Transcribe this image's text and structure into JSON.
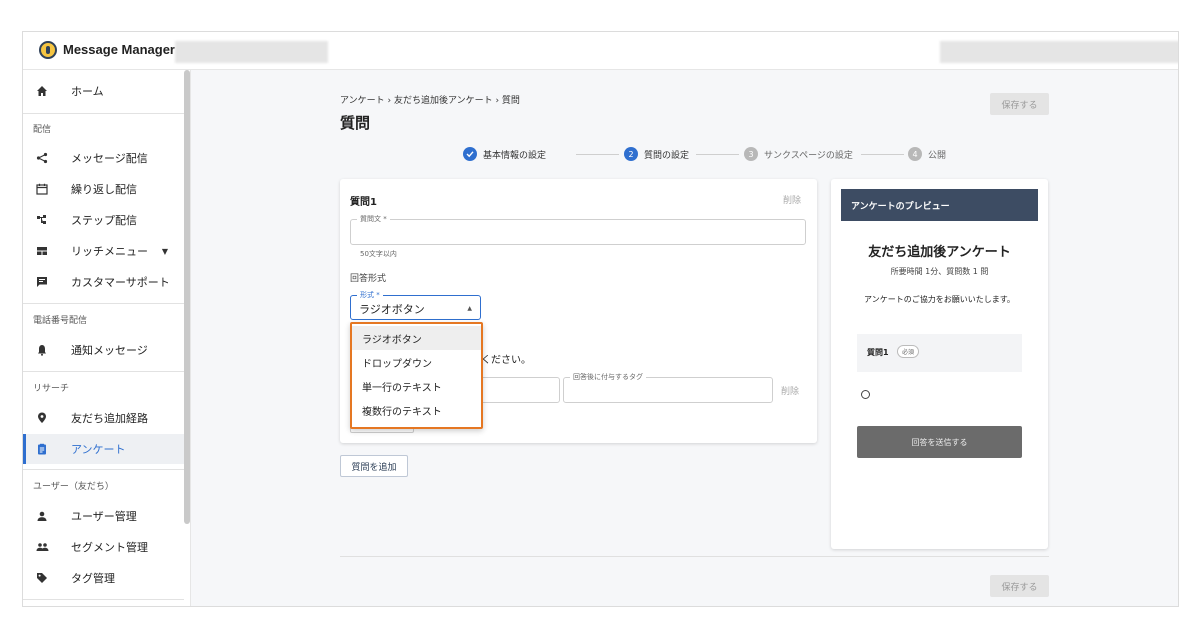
{
  "app": {
    "title": "Message Manager"
  },
  "sidebar": {
    "home": "ホーム",
    "section_delivery": "配信",
    "message_delivery": "メッセージ配信",
    "repeat_delivery": "繰り返し配信",
    "step_delivery": "ステップ配信",
    "rich_menu": "リッチメニュー",
    "customer_support": "カスタマーサポート",
    "section_phone": "電話番号配信",
    "notification_message": "通知メッセージ",
    "section_research": "リサーチ",
    "friend_route": "友だち追加経路",
    "survey": "アンケート",
    "section_users": "ユーザー（友だち）",
    "user_management": "ユーザー管理",
    "segment_management": "セグメント管理",
    "tag_management": "タグ管理"
  },
  "breadcrumb": "アンケート › 友だち追加後アンケート › 質問",
  "page_title": "質問",
  "save_label": "保存する",
  "stepper": {
    "step1": "基本情報の設定",
    "step2_num": "2",
    "step2": "質問の設定",
    "step3_num": "3",
    "step3": "サンクスページの設定",
    "step4_num": "4",
    "step4": "公開"
  },
  "question": {
    "title": "質問1",
    "delete": "削除",
    "text_label": "質問文 *",
    "text_value": "",
    "helper": "50文字以内",
    "answer_format": "回答形式",
    "format_label": "形式 *",
    "format_value": "ラジオボタン",
    "instruction_tail": "ください。",
    "tag_label": "回答後に付与するタグ",
    "option_delete": "削除"
  },
  "dropdown_options": [
    "ラジオボタン",
    "ドロップダウン",
    "単一行のテキスト",
    "複数行のテキスト"
  ],
  "add_question": "質問を追加",
  "preview": {
    "header": "アンケートのプレビュー",
    "title": "友だち追加後アンケート",
    "meta": "所要時間 1分、質問数 1 問",
    "description": "アンケートのご協力をお願いいたします。",
    "question_label": "質問1",
    "required_badge": "必須",
    "submit": "回答を送信する"
  },
  "colors": {
    "accent": "#2f6fcf",
    "highlight": "#e57722",
    "preview_header": "#3d4c63"
  }
}
